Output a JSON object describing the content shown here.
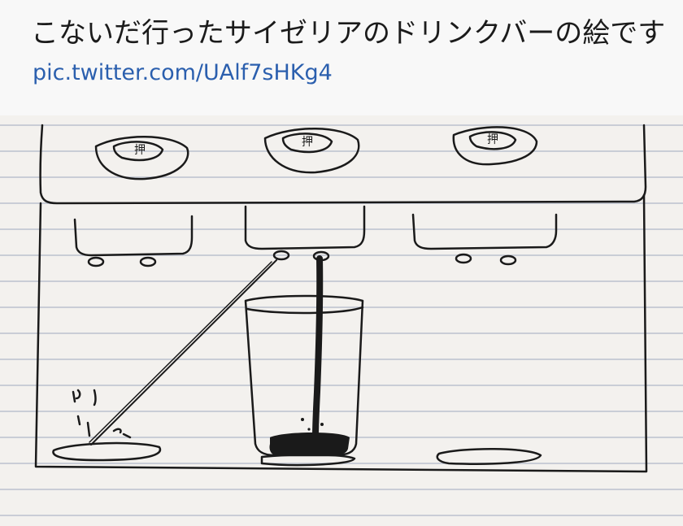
{
  "tweet": {
    "text": "こないだ行ったサイゼリアのドリンクバーの絵です",
    "link": "pic.twitter.com/UAlf7sHKg4"
  },
  "drawing": {
    "button_label": "押",
    "colors": {
      "paper": "#f3f1ee",
      "rule_line": "#c9cdd6",
      "ink": "#1a1a1a",
      "link": "#2b5fae"
    }
  }
}
